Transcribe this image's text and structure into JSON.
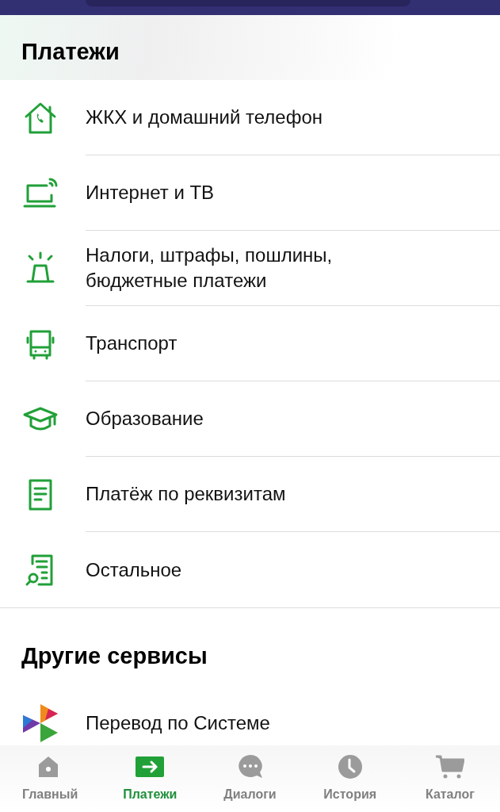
{
  "sections": [
    {
      "title": "Платежи",
      "items": [
        {
          "label": "ЖКХ и домашний телефон"
        },
        {
          "label": "Интернет и ТВ"
        },
        {
          "label": "Налоги, штрафы, пошлины, бюджетные платежи"
        },
        {
          "label": "Транспорт"
        },
        {
          "label": "Образование"
        },
        {
          "label": "Платёж по реквизитам"
        },
        {
          "label": "Остальное"
        }
      ]
    },
    {
      "title": "Другие сервисы",
      "items": [
        {
          "label": "Перевод по Системе"
        }
      ]
    }
  ],
  "tabs": [
    {
      "label": "Главный",
      "selected": false
    },
    {
      "label": "Платежи",
      "selected": true
    },
    {
      "label": "Диалоги",
      "selected": false
    },
    {
      "label": "История",
      "selected": false
    },
    {
      "label": "Каталог",
      "selected": false
    }
  ]
}
